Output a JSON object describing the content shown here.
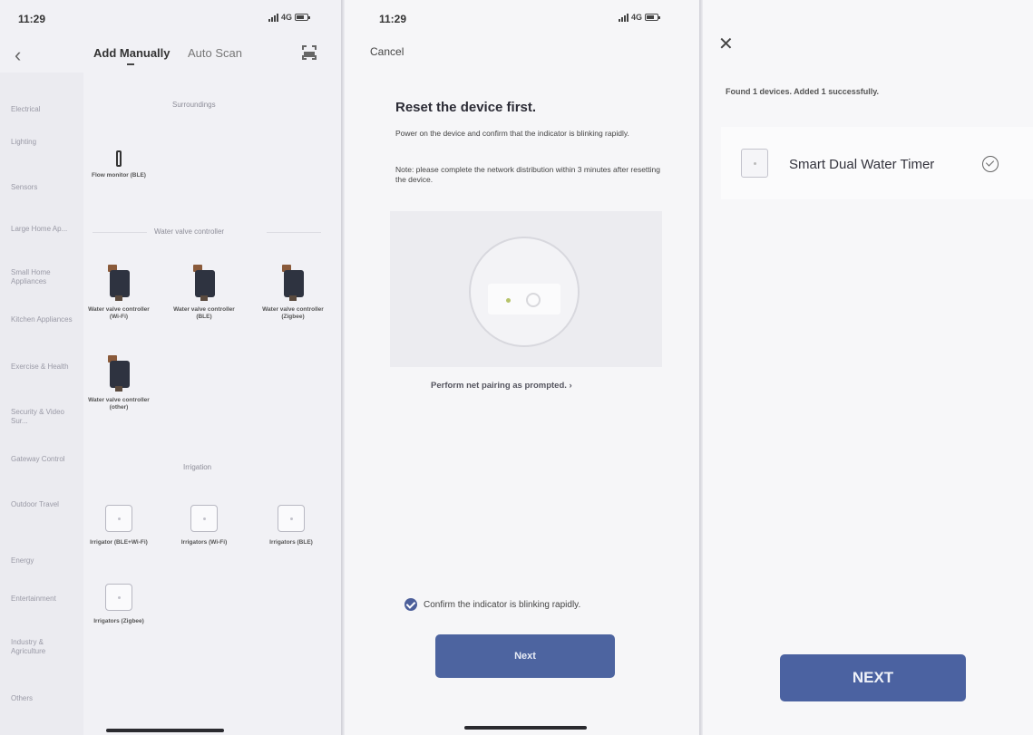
{
  "screen1": {
    "status_time": "11:29",
    "status_network": "4G",
    "tabs": {
      "active": "Add Manually",
      "other": "Auto Scan"
    },
    "sidebar": [
      "Electrical",
      "Lighting",
      "Sensors",
      "Large Home Ap...",
      "Small Home Appliances",
      "Kitchen Appliances",
      "Exercise & Health",
      "Security & Video Sur...",
      "Gateway Control",
      "Outdoor Travel",
      "Energy",
      "Entertainment",
      "Industry & Agriculture",
      "Others"
    ],
    "sections": {
      "surroundings": "Surroundings",
      "valve": "Water valve controller",
      "irrigation": "Irrigation"
    },
    "devices": {
      "flow_monitor": "Flow monitor (BLE)",
      "valve_wifi": "Water valve controller (Wi-Fi)",
      "valve_ble": "Water valve controller (BLE)",
      "valve_zigbee": "Water valve controller (Zigbee)",
      "valve_other": "Water valve controller (other)",
      "irr_ble_wifi": "Irrigator (BLE+Wi-Fi)",
      "irr_wifi": "Irrigators (Wi-Fi)",
      "irr_ble": "Irrigators (BLE)",
      "irr_zigbee": "Irrigators (Zigbee)"
    }
  },
  "screen2": {
    "status_time": "11:29",
    "status_network": "4G",
    "cancel": "Cancel",
    "title": "Reset the device first.",
    "line1": "Power on the device and confirm that the indicator is blinking rapidly.",
    "line2": "Note: please complete the network distribution within 3 minutes after resetting the device.",
    "pairing_link": "Perform net pairing as prompted. ›",
    "confirm": "Confirm the indicator is blinking rapidly.",
    "next": "Next"
  },
  "screen3": {
    "found": "Found 1 devices. Added 1 successfully.",
    "device_name": "Smart Dual Water Timer",
    "next": "NEXT"
  }
}
